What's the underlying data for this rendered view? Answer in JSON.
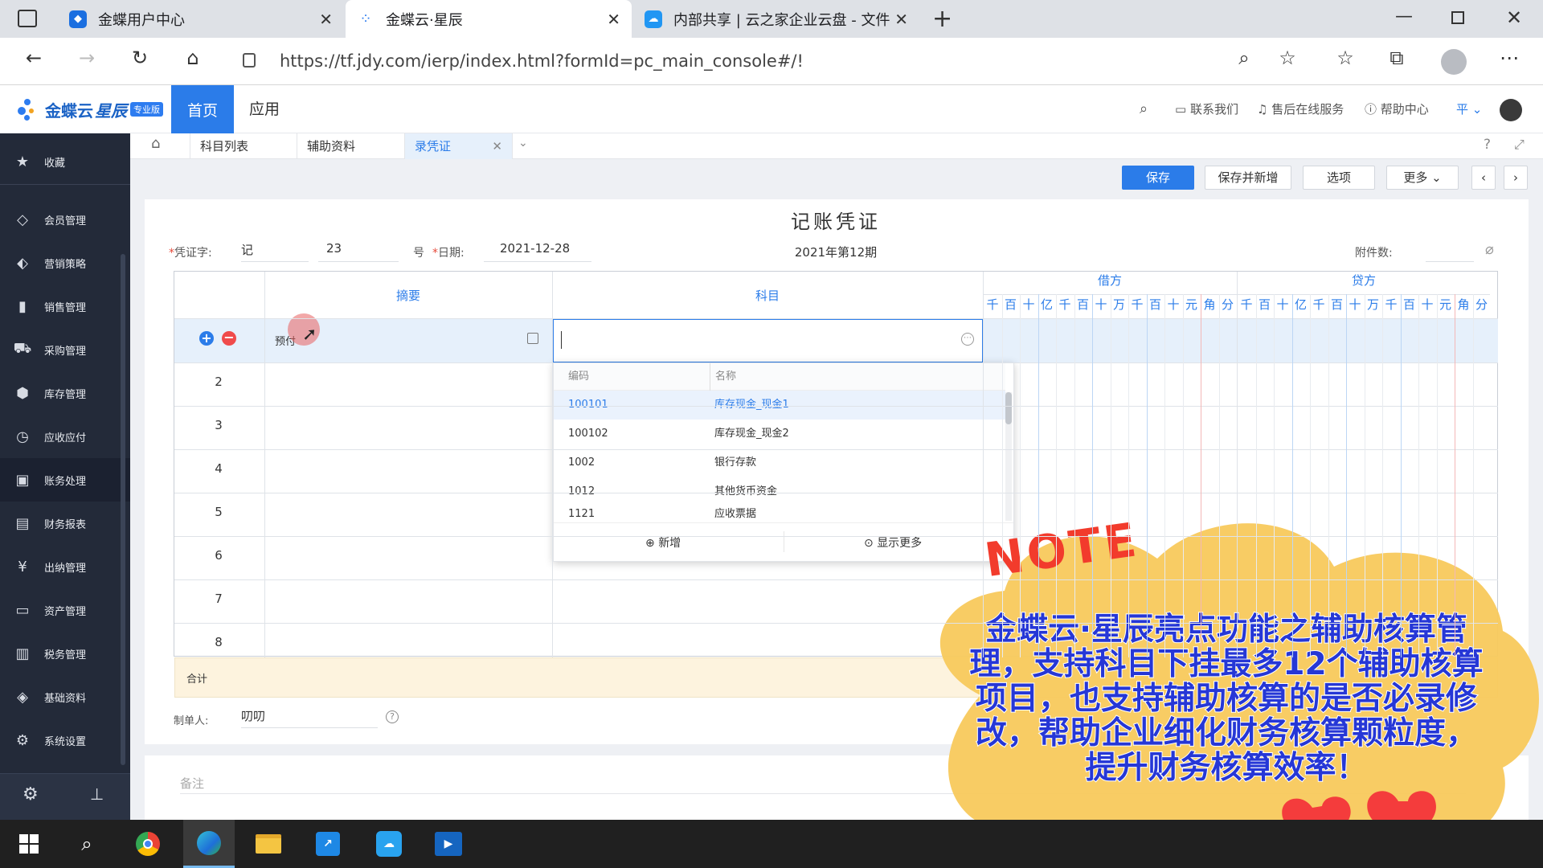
{
  "browser": {
    "tabs": [
      {
        "title": "金蝶用户中心"
      },
      {
        "title": "金蝶云·星辰"
      },
      {
        "title": "内部共享 | 云之家企业云盘 - 文件"
      }
    ],
    "url": "https://tf.jdy.com/ierp/index.html?formId=pc_main_console#/!"
  },
  "app": {
    "logo_text": "金蝶云",
    "logo_sub": "星辰",
    "logo_badge": "专业版",
    "nav": {
      "home": "首页",
      "apps": "应用"
    },
    "header_links": [
      "联系我们",
      "售后在线服务",
      "帮助中心",
      "平"
    ]
  },
  "sidebar": {
    "items": [
      {
        "label": "收藏",
        "icon": "star-icon"
      },
      {
        "label": "会员管理",
        "icon": "diamond-icon"
      },
      {
        "label": "营销策略",
        "icon": "tag-icon"
      },
      {
        "label": "销售管理",
        "icon": "bar-chart-icon"
      },
      {
        "label": "采购管理",
        "icon": "cart-icon"
      },
      {
        "label": "库存管理",
        "icon": "box-icon"
      },
      {
        "label": "应收应付",
        "icon": "clock-icon"
      },
      {
        "label": "账务处理",
        "icon": "ledger-icon"
      },
      {
        "label": "财务报表",
        "icon": "report-icon"
      },
      {
        "label": "出纳管理",
        "icon": "cash-icon"
      },
      {
        "label": "资产管理",
        "icon": "asset-icon"
      },
      {
        "label": "税务管理",
        "icon": "tax-icon"
      },
      {
        "label": "基础资料",
        "icon": "layers-icon"
      },
      {
        "label": "系统设置",
        "icon": "gear-icon"
      }
    ]
  },
  "content_tabs": [
    "科目列表",
    "辅助资料",
    "录凭证"
  ],
  "toolbar": {
    "save": "保存",
    "save_new": "保存并新增",
    "options": "选项",
    "more": "更多"
  },
  "voucher": {
    "title": "记账凭证",
    "word_label": "凭证字:",
    "word_value": "记",
    "number": "23",
    "number_suffix": "号",
    "date_label": "日期:",
    "date_value": "2021-12-28",
    "period": "2021年第12期",
    "attach_label": "附件数:",
    "col_summary": "摘要",
    "col_subject": "科目",
    "col_debit": "借方",
    "col_credit": "贷方",
    "units": [
      "千",
      "百",
      "十",
      "亿",
      "千",
      "百",
      "十",
      "万",
      "千",
      "百",
      "十",
      "元",
      "角",
      "分"
    ],
    "row1_summary": "预付",
    "rows": [
      "2",
      "3",
      "4",
      "5",
      "6",
      "7",
      "8"
    ],
    "total_label": "合计",
    "maker_label": "制单人:",
    "maker_value": "叨叨",
    "remark_placeholder": "备注"
  },
  "dropdown": {
    "col_code": "编码",
    "col_name": "名称",
    "items": [
      {
        "code": "100101",
        "name": "库存现金_现金1"
      },
      {
        "code": "100102",
        "name": "库存现金_现金2"
      },
      {
        "code": "1002",
        "name": "银行存款"
      },
      {
        "code": "1012",
        "name": "其他货币资金"
      },
      {
        "code": "1121",
        "name": "应收票据"
      }
    ],
    "add": "新增",
    "show_more": "显示更多"
  },
  "note": {
    "word": "NOTE",
    "text": "金蝶云·星辰亮点功能之辅助核算管理，支持科目下挂最多12个辅助核算项目，也支持辅助核算的是否必录修改，帮助企业细化财务核算颗粒度，提升财务核算效率！"
  }
}
